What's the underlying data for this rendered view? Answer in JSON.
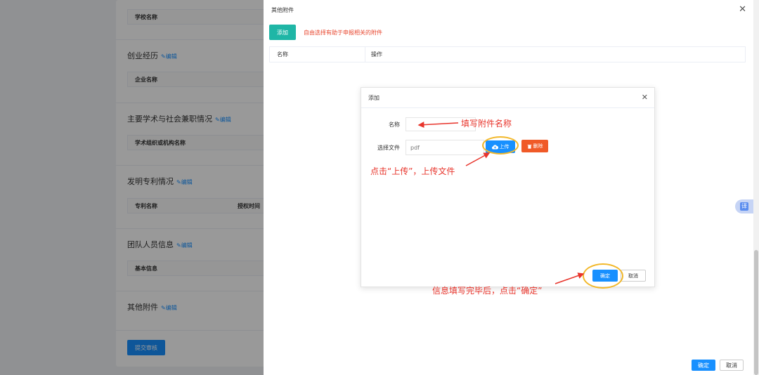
{
  "background": {
    "sections": [
      {
        "title": "",
        "table_header": "学校名称"
      },
      {
        "title": "创业经历",
        "edit": "编辑",
        "table_header": "企业名称"
      },
      {
        "title": "主要学术与社会兼职情况",
        "edit": "编辑",
        "table_header": "学术组织或机构名称"
      },
      {
        "title": "发明专利情况",
        "edit": "编辑",
        "table_header": "专利名称",
        "table_header_2": "授权时间"
      },
      {
        "title": "团队人员信息",
        "edit": "编辑",
        "table_header": "基本信息"
      },
      {
        "title": "其他附件",
        "edit": "编辑"
      }
    ],
    "submit_label": "提交审核"
  },
  "drawer": {
    "title": "其他附件",
    "add_label": "添加",
    "hint": "自由选择有助于申报相关的附件",
    "columns": [
      "名称",
      "操作"
    ],
    "ok_label": "确定",
    "cancel_label": "取消"
  },
  "dialog": {
    "title": "添加",
    "name_label": "名称",
    "file_label": "选择文件",
    "file_placeholder": "pdf",
    "upload_label": "上传",
    "delete_label": "删除",
    "ok_label": "确定",
    "cancel_label": "取消"
  },
  "annotations": {
    "name_note": "填写附件名称",
    "upload_note": "点击“上传”，上传文件",
    "confirm_note": "信息填写完毕后，点击“确定”"
  },
  "float_button": {
    "label": "译"
  },
  "colors": {
    "primary": "#1890ff",
    "teal": "#1fb6a6",
    "danger": "#f05a28",
    "annotation": "#e8342b",
    "highlight": "#f2b82a"
  }
}
